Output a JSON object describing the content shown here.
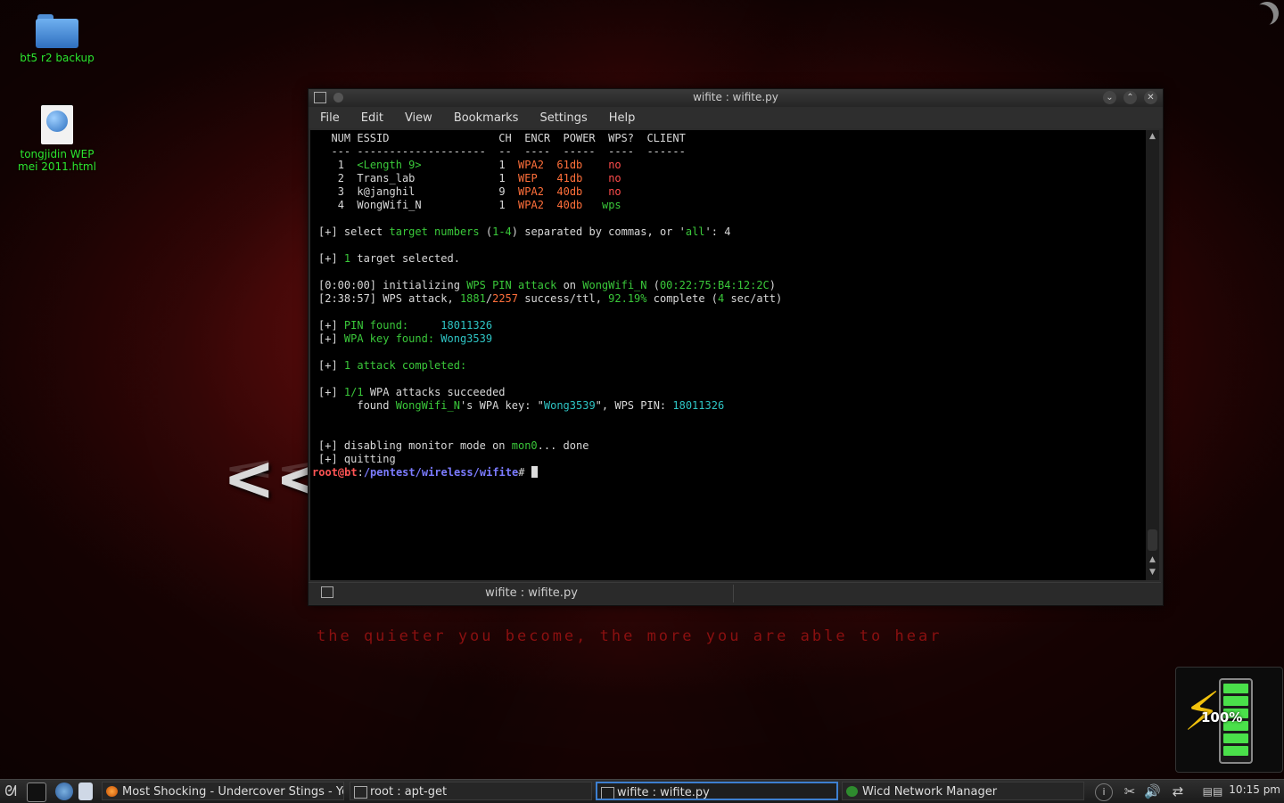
{
  "desktop": {
    "icons": [
      {
        "label": "bt5 r2 backup",
        "icon": "folder-icon"
      },
      {
        "label": "tongjidin WEP\nmei 2011.html",
        "icon": "html-file-icon"
      }
    ],
    "tagline": "the quieter you become, the more you are able to hear",
    "chevrons": "<<"
  },
  "window": {
    "title": "wifite : wifite.py",
    "menu": [
      "File",
      "Edit",
      "View",
      "Bookmarks",
      "Settings",
      "Help"
    ],
    "tab_label": "wifite : wifite.py"
  },
  "terminal": {
    "header": "  NUM ESSID                 CH  ENCR  POWER  WPS?  CLIENT",
    "divider": "  --- --------------------  --  ----  -----  ----  ------",
    "targets": [
      {
        "num": "1",
        "essid": "<Length 9>",
        "ch": "1",
        "encr": "WPA2",
        "power": "61db",
        "wps": "no"
      },
      {
        "num": "2",
        "essid": "Trans_lab",
        "ch": "1",
        "encr": "WEP",
        "power": "41db",
        "wps": "no"
      },
      {
        "num": "3",
        "essid": "k@janghil",
        "ch": "9",
        "encr": "WPA2",
        "power": "40db",
        "wps": "no"
      },
      {
        "num": "4",
        "essid": "WongWifi_N",
        "ch": "1",
        "encr": "WPA2",
        "power": "40db",
        "wps": "wps"
      }
    ],
    "select_prompt": {
      "prefix": "[+] select ",
      "a": "target numbers",
      "b": " (",
      "range": "1-4",
      "c": ") separated by commas, or '",
      "all": "all",
      "d": "': 4"
    },
    "selected": {
      "prefix": "[+] ",
      "count": "1",
      "rest": " target selected."
    },
    "init": {
      "time": "[0:00:00]",
      "text": " initializing ",
      "attack": "WPS PIN attack",
      "on": " on ",
      "essid": "WongWifi_N",
      "open": " (",
      "bssid": "00:22:75:B4:12:2C",
      "close": ")"
    },
    "progress": {
      "time": "[2:38:57]",
      "text": " WPS attack, ",
      "done": "1881",
      "slash": "/",
      "total": "2257",
      "mid": " success/ttl, ",
      "pct": "92.19%",
      "tail1": " complete (",
      "rate": "4",
      "tail2": " sec/att)"
    },
    "pin_found": {
      "prefix": "[+] ",
      "label": "PIN found:     ",
      "value": "18011326"
    },
    "key_found": {
      "prefix": "[+] ",
      "label": "WPA key found: ",
      "value": "Wong3539"
    },
    "completed": {
      "prefix": "[+] ",
      "text": "1 attack completed:"
    },
    "succeeded": {
      "prefix": "[+] ",
      "ratio": "1/1",
      "text": " WPA attacks succeeded"
    },
    "found": {
      "a": "      found ",
      "essid": "WongWifi_N",
      "b": "'s WPA key: \"",
      "key": "Wong3539",
      "c": "\", WPS PIN: ",
      "pin": "18011326"
    },
    "disabling": {
      "a": "[+] disabling monitor mode on ",
      "iface": "mon0",
      "b": "... done"
    },
    "quitting": "[+] quitting",
    "prompt": {
      "user": "root",
      "at": "@",
      "host": "bt",
      "colon": ":",
      "path": "/pentest/wireless/wifite",
      "hash": "# "
    }
  },
  "battery": {
    "percent": "100%"
  },
  "taskbar": {
    "tasks": [
      {
        "label": "Most Shocking - Undercover Stings - You",
        "icon": "firefox-icon"
      },
      {
        "label": "root : apt-get",
        "icon": "terminal-icon"
      },
      {
        "label": "wifite : wifite.py",
        "icon": "terminal-icon"
      },
      {
        "label": "Wicd Network Manager",
        "icon": "wicd-icon"
      }
    ],
    "clock": "10:15 pm"
  }
}
